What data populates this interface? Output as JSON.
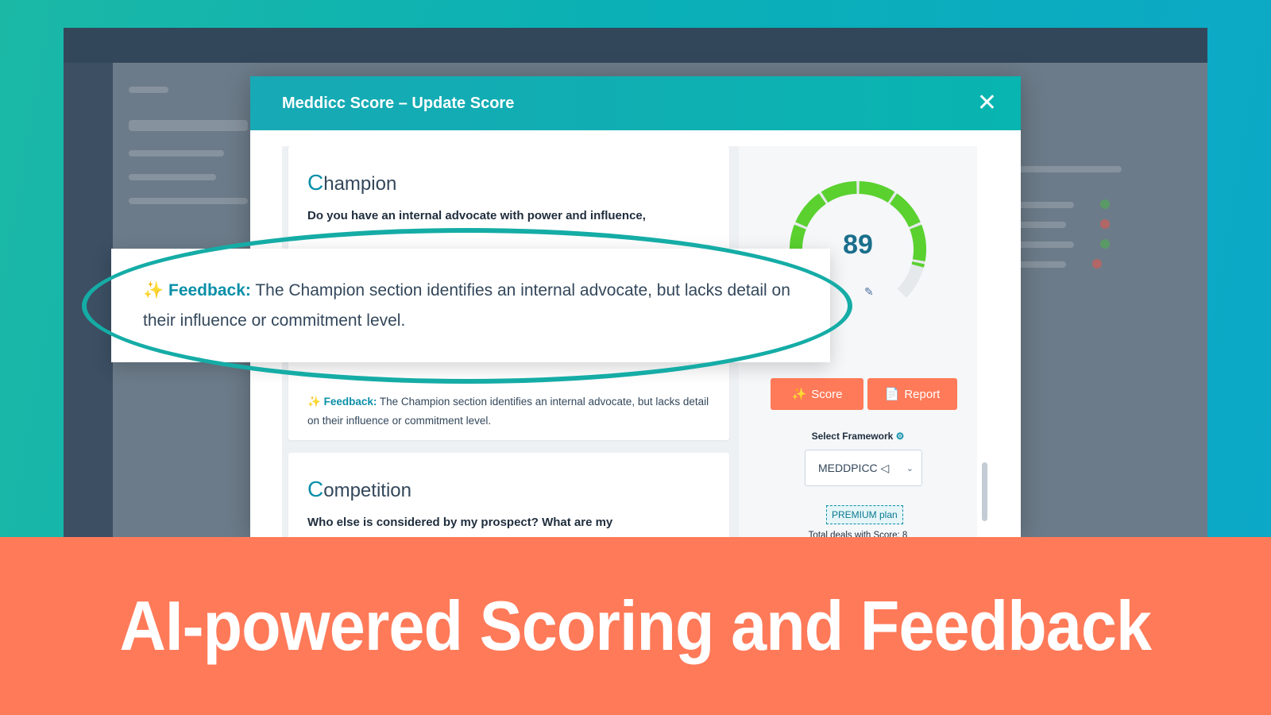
{
  "modal": {
    "title": "Meddicc Score – Update Score",
    "close_icon": "close-icon"
  },
  "champion": {
    "title_cap": "C",
    "title_rest": "hampion",
    "question_line1": "Do you have an internal advocate with power and influence,",
    "feedback_label": "Feedback:",
    "feedback_text": "The Champion section identifies an internal advocate, but lacks detail on their influence or commitment level."
  },
  "competition": {
    "title_cap": "C",
    "title_rest": "ompetition",
    "question_line1": "Who else is considered by my prospect? What are my"
  },
  "score": {
    "value": "89",
    "gauge_fraction": 0.89,
    "gauge_color": "#5ad12f",
    "score_button": "Score",
    "report_button": "Report"
  },
  "framework": {
    "label": "Select Framework",
    "selected": "MEDDPICC ◁",
    "plan": "PREMIUM plan",
    "deals": "Total deals with Score: 8"
  },
  "callout": {
    "feedback_label": "Feedback:",
    "feedback_text": "The Champion section identifies an internal advocate, but lacks detail on their influence or commitment level."
  },
  "banner": {
    "text": "AI-powered Scoring and Feedback",
    "color": "#ff7a59"
  }
}
